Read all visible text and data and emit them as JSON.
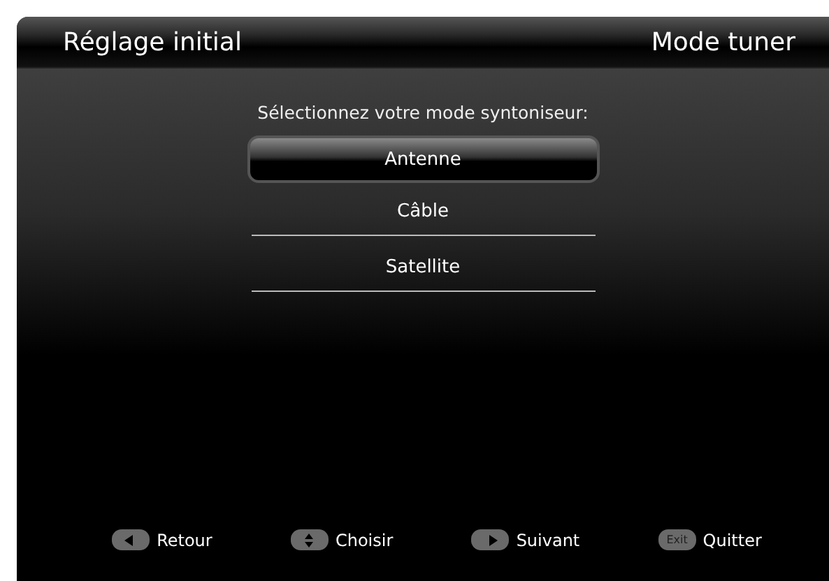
{
  "header": {
    "title": "Réglage initial",
    "section": "Mode tuner"
  },
  "prompt": "Sélectionnez votre mode syntoniseur:",
  "options": [
    {
      "label": "Antenne",
      "selected": true
    },
    {
      "label": "Câble",
      "selected": false
    },
    {
      "label": "Satellite",
      "selected": false
    }
  ],
  "hints": [
    {
      "kind": "left",
      "label": "Retour"
    },
    {
      "kind": "updown",
      "label": "Choisir"
    },
    {
      "kind": "right",
      "label": "Suivant"
    },
    {
      "kind": "exit",
      "key": "Exit",
      "label": "Quitter"
    }
  ]
}
